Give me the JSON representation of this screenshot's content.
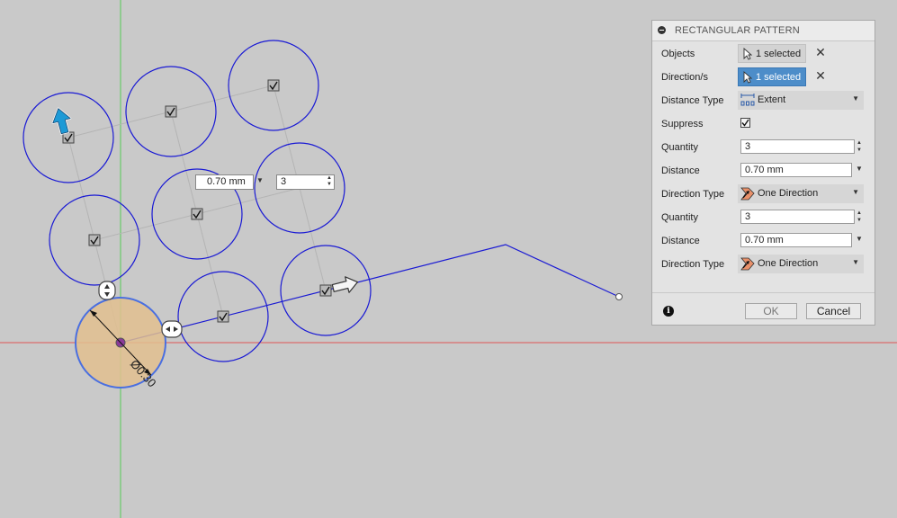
{
  "inline_inputs": {
    "distance": "0.70 mm",
    "quantity": "3"
  },
  "sketch": {
    "diameter_label": "Ø0.30"
  },
  "dialog": {
    "title": "RECTANGULAR PATTERN",
    "objects": {
      "label": "Objects",
      "value": "1 selected"
    },
    "directions": {
      "label": "Direction/s",
      "value": "1 selected"
    },
    "distance_type": {
      "label": "Distance Type",
      "value": "Extent"
    },
    "suppress": {
      "label": "Suppress",
      "checked": true
    },
    "dir1": {
      "quantity_label": "Quantity",
      "quantity": "3",
      "distance_label": "Distance",
      "distance": "0.70 mm",
      "direction_type_label": "Direction Type",
      "direction_type": "One Direction"
    },
    "dir2": {
      "quantity_label": "Quantity",
      "quantity": "3",
      "distance_label": "Distance",
      "distance": "0.70 mm",
      "direction_type_label": "Direction Type",
      "direction_type": "One Direction"
    },
    "ok_label": "OK",
    "cancel_label": "Cancel"
  },
  "colors": {
    "canvas": "#c9c9c9",
    "circle_stroke": "#1a1ad4",
    "selected_fill": "#e2c08f",
    "axis_red": "#e05555",
    "axis_green": "#55cc55",
    "active_button": "#4d8dc9",
    "arrow_blue": "#1d9ad6"
  },
  "icons": [
    "collapse-icon",
    "cursor-icon",
    "close-icon",
    "extent-icon",
    "one-direction-icon",
    "chevron-down-icon",
    "info-icon",
    "checkbox-icon",
    "arrow-manipulator-icon"
  ]
}
